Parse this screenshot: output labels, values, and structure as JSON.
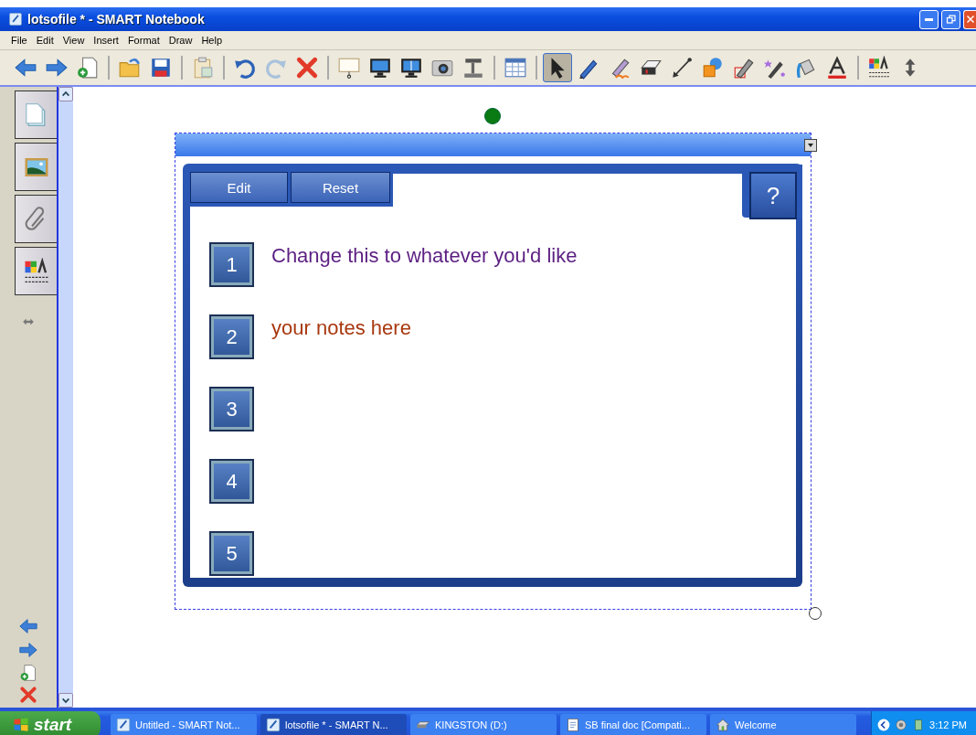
{
  "window": {
    "title": "lotsofile * - SMART Notebook"
  },
  "menu": [
    "File",
    "Edit",
    "View",
    "Insert",
    "Format",
    "Draw",
    "Help"
  ],
  "toolbar": [
    {
      "kind": "back",
      "selected": false
    },
    {
      "kind": "forward",
      "selected": false
    },
    {
      "kind": "addpage",
      "selected": false
    },
    {
      "kind": "sep"
    },
    {
      "kind": "open",
      "selected": false
    },
    {
      "kind": "save",
      "selected": false
    },
    {
      "kind": "sep"
    },
    {
      "kind": "paste",
      "selected": false
    },
    {
      "kind": "sep"
    },
    {
      "kind": "undo",
      "selected": false
    },
    {
      "kind": "redo",
      "selected": false
    },
    {
      "kind": "delete",
      "selected": false
    },
    {
      "kind": "sep"
    },
    {
      "kind": "shade",
      "selected": false
    },
    {
      "kind": "fullscreen",
      "selected": false
    },
    {
      "kind": "dual",
      "selected": false
    },
    {
      "kind": "capture",
      "selected": false
    },
    {
      "kind": "doccam",
      "selected": false
    },
    {
      "kind": "sep"
    },
    {
      "kind": "table",
      "selected": false
    },
    {
      "kind": "sep"
    },
    {
      "kind": "select",
      "selected": true
    },
    {
      "kind": "pen",
      "selected": false
    },
    {
      "kind": "creative",
      "selected": false
    },
    {
      "kind": "eraser",
      "selected": false
    },
    {
      "kind": "line",
      "selected": false
    },
    {
      "kind": "shapes",
      "selected": false
    },
    {
      "kind": "recog",
      "selected": false
    },
    {
      "kind": "magic",
      "selected": false
    },
    {
      "kind": "fill",
      "selected": false
    },
    {
      "kind": "text",
      "selected": false
    },
    {
      "kind": "sep"
    },
    {
      "kind": "props",
      "selected": false
    },
    {
      "kind": "move",
      "selected": false
    }
  ],
  "sidebar": {
    "tabs": [
      {
        "kind": "pages"
      },
      {
        "kind": "gallery"
      },
      {
        "kind": "attach"
      },
      {
        "kind": "props"
      }
    ]
  },
  "widget": {
    "buttons": [
      "Edit",
      "Reset"
    ],
    "help": "?",
    "notes": [
      {
        "number": "1",
        "text": "Change this to whatever you'd like",
        "color": "#5c1f82"
      },
      {
        "number": "2",
        "text": "your notes here",
        "color": "#a8380f"
      },
      {
        "number": "3"
      },
      {
        "number": "4"
      },
      {
        "number": "5"
      }
    ]
  },
  "taskbar": {
    "start": "start",
    "tasks": [
      {
        "label": "Untitled - SMART Not...",
        "kind": "notebook",
        "selected": false
      },
      {
        "label": "lotsofile * - SMART N...",
        "kind": "notebook",
        "selected": true
      },
      {
        "label": "KINGSTON (D:)",
        "kind": "drive",
        "selected": false
      },
      {
        "label": "SB final doc [Compati...",
        "kind": "doc",
        "selected": false
      },
      {
        "label": "Welcome",
        "kind": "home",
        "selected": false
      }
    ],
    "clock": "3:12 PM"
  }
}
